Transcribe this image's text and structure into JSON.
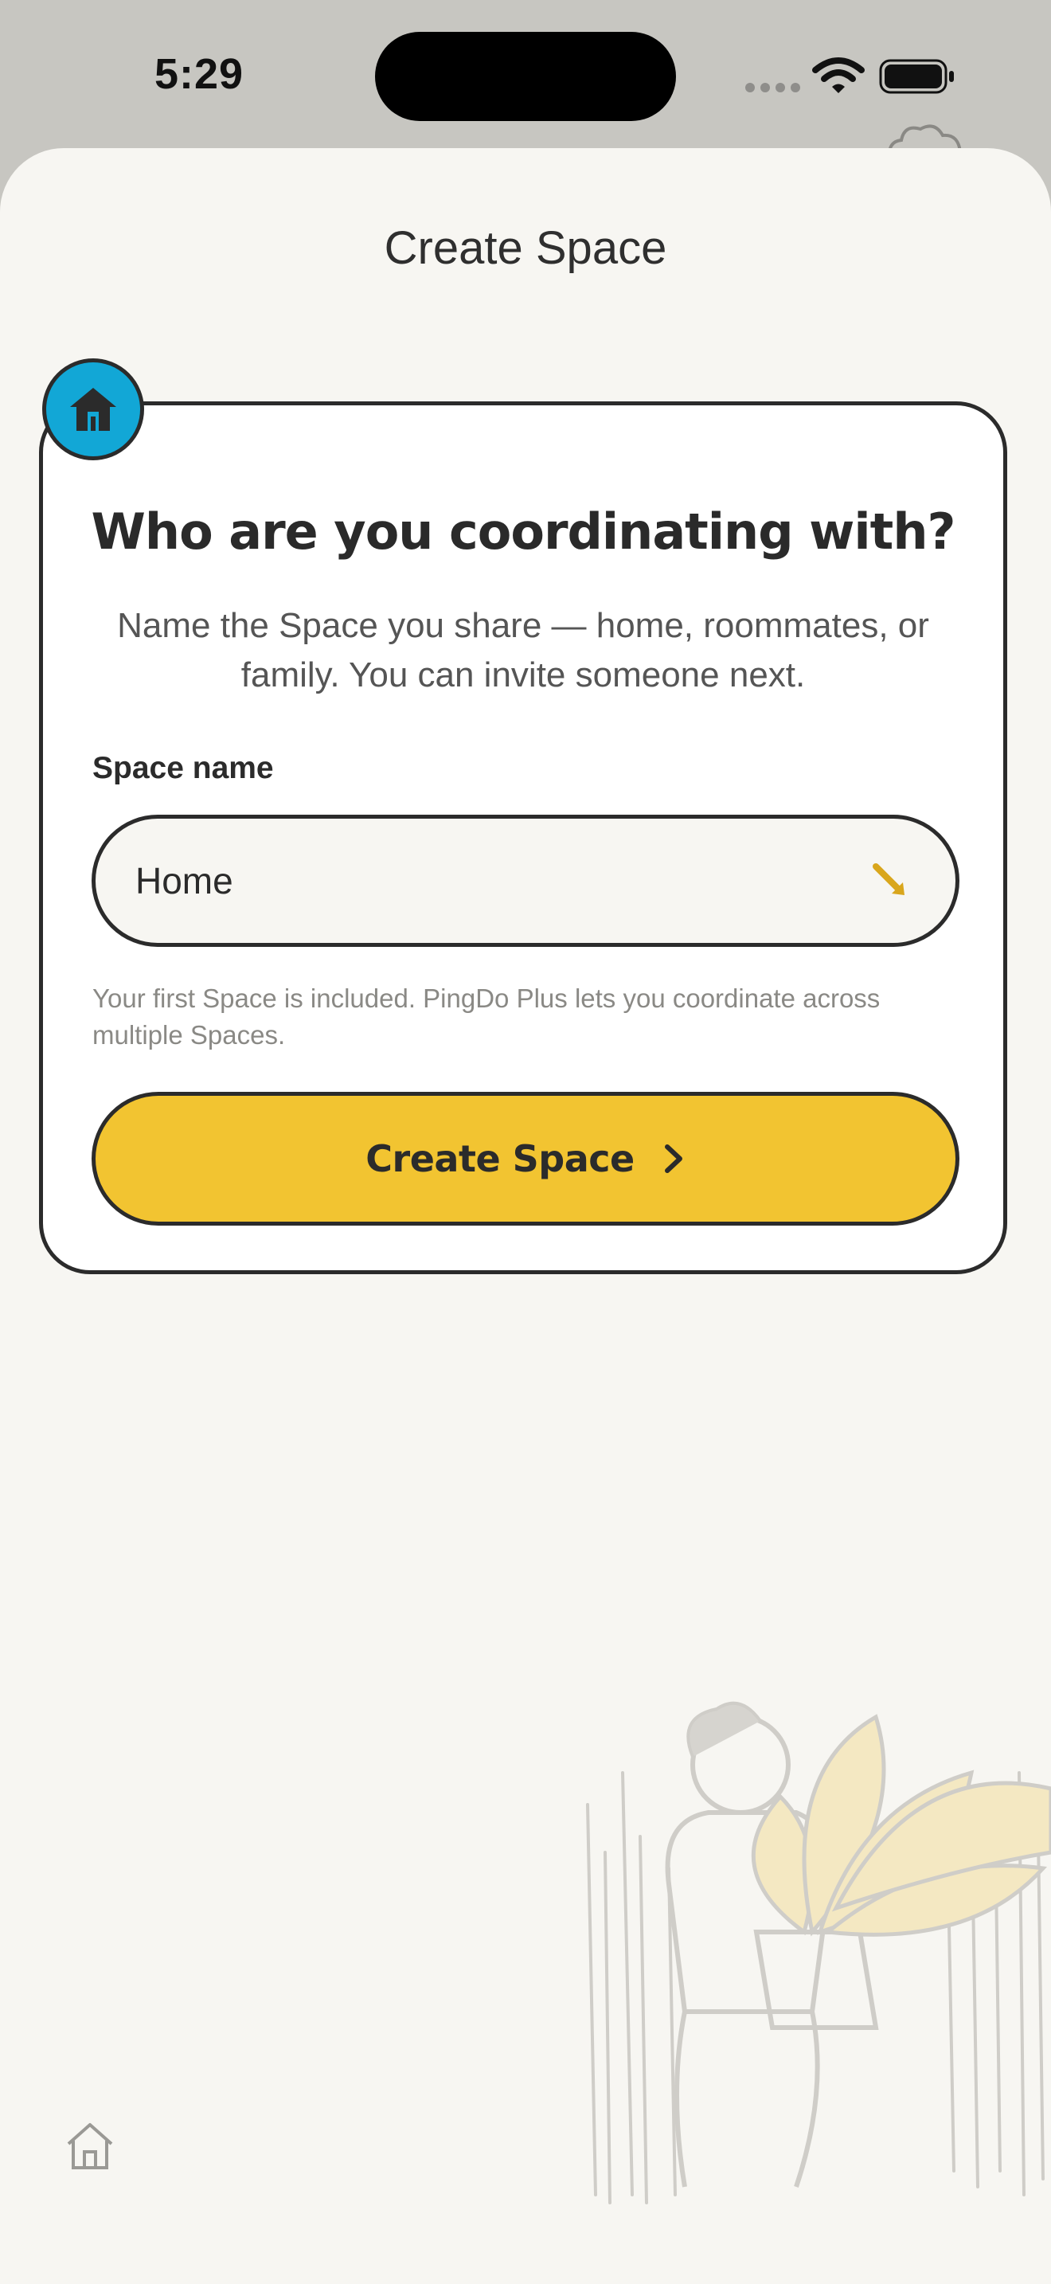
{
  "status_bar": {
    "time": "5:29",
    "icons": [
      "signal-icon",
      "wifi-icon",
      "battery-icon"
    ]
  },
  "header": {
    "title": "Create Space"
  },
  "card": {
    "badge_icon": "house-icon",
    "heading": "Who are you coordinating with?",
    "subtitle": "Name the Space you share — home, roommates, or family. You can invite someone next.",
    "field_label": "Space name",
    "field_value": "Home",
    "field_icon": "pencil-icon",
    "note": "Your first Space is included. PingDo Plus lets you coordinate across multiple Spaces.",
    "button_label": "Create Space",
    "button_icon": "chevron-right-icon"
  },
  "footer": {
    "icon": "home-tab-icon"
  },
  "colors": {
    "background": "#f7f6f2",
    "accent_yellow": "#f2c431",
    "accent_blue": "#12a7d6",
    "ink": "#2b2b2b"
  }
}
